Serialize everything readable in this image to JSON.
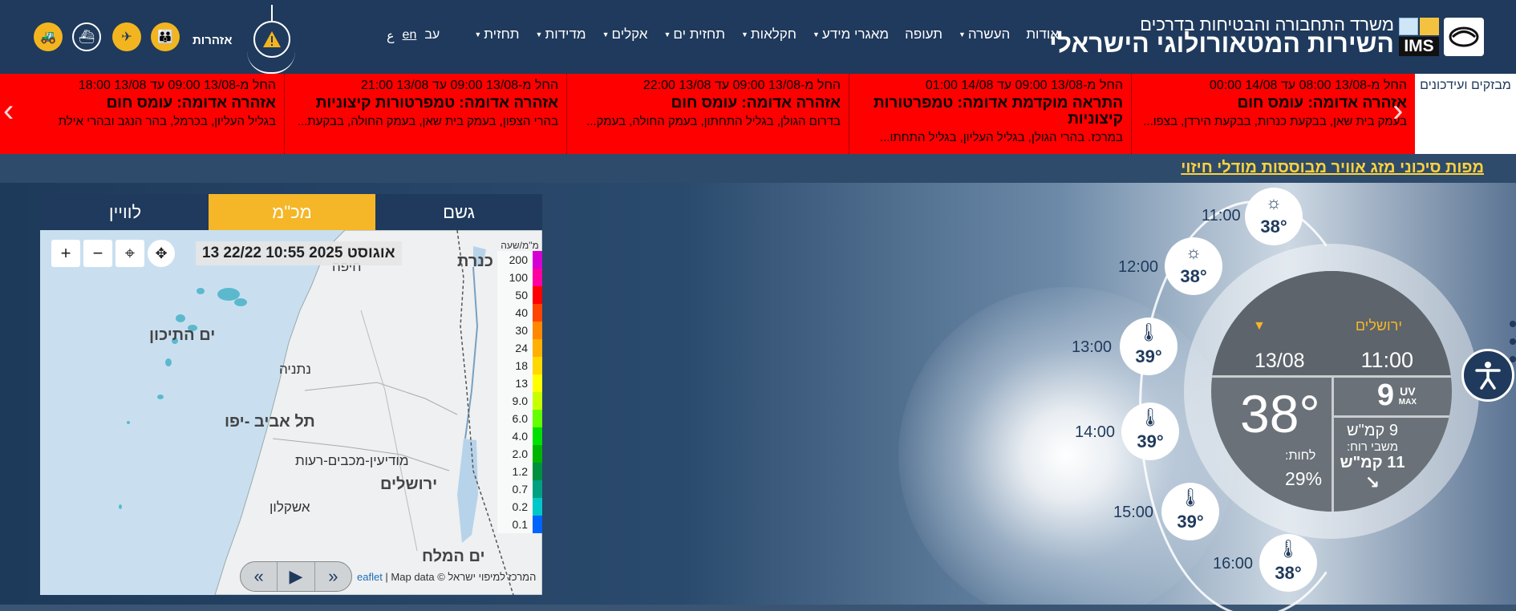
{
  "header": {
    "org_subtitle": "משרד התחבורה והבטיחות בדרכים",
    "org_title": "השירות המטאורולוגי הישראלי",
    "ims_logo_text": "IMS",
    "nav": [
      {
        "label": "תחזית",
        "caret": true
      },
      {
        "label": "מדידות",
        "caret": true
      },
      {
        "label": "אקלים",
        "caret": true
      },
      {
        "label": "תחזית ים",
        "caret": true
      },
      {
        "label": "חקלאות",
        "caret": true
      },
      {
        "label": "מאגרי מידע",
        "caret": true
      },
      {
        "label": "תעופה",
        "caret": false
      },
      {
        "label": "העשרה",
        "caret": true
      },
      {
        "label": "אודות",
        "caret": false
      }
    ],
    "lang_he": "עב",
    "lang_en": "en",
    "lang_ar": "ع",
    "alerts_label": "אזהרות",
    "icons": [
      "warning-icon",
      "people-icon",
      "plane-icon",
      "ship-icon",
      "tractor-icon"
    ]
  },
  "warnings": {
    "tab_label": "מבזקים ועידכונים",
    "cards": [
      {
        "time": "החל מ-13/08 08:00 עד 14/08 00:00",
        "title": "אזהרה אדומה: עומס חום",
        "area": "בעמק בית שאן, בבקעת כנרות, בבקעת הירדן, בצפו..."
      },
      {
        "time": "החל מ-13/08 09:00 עד 14/08 01:00",
        "title": "התראה מוקדמת אדומה: טמפרטורות קיצוניות",
        "area": "במרכז. בהרי הגולן, בגליל העליון, בגליל התחתו..."
      },
      {
        "time": "החל מ-13/08 09:00 עד 13/08 22:00",
        "title": "אזהרה אדומה: עומס חום",
        "area": "בדרום הגולן, בגליל התחתון, בעמק החולה, בעמק..."
      },
      {
        "time": "החל מ-13/08 09:00 עד 13/08 21:00",
        "title": "אזהרה אדומה: טמפרטורות קיצוניות",
        "area": "בהרי הצפון, בעמק בית שאן, בעמק החולה, בבקעת..."
      },
      {
        "time": "החל מ-13/08 09:00 עד 13/08 18:00",
        "title": "אזהרה אדומה: עומס חום",
        "area": "בגליל העליון, בכרמל, בהר הנגב ובהרי אילת"
      }
    ],
    "color": "#ff0000"
  },
  "risk_link": "מפות סיכוני מזג אוויר מבוססות מודלי חיזוי",
  "map": {
    "tabs": [
      "גשם",
      "מכ\"מ",
      "לוויין"
    ],
    "active_tab": 1,
    "timestamp": "13 אוגוסט 2025 10:55 22/22",
    "legend_unit": "מ\"מ/שעה",
    "legend": [
      {
        "v": "200",
        "c": "#d400d4"
      },
      {
        "v": "100",
        "c": "#ff00a0"
      },
      {
        "v": "50",
        "c": "#ff0000"
      },
      {
        "v": "40",
        "c": "#ff4400"
      },
      {
        "v": "30",
        "c": "#ff8800"
      },
      {
        "v": "24",
        "c": "#ffb000"
      },
      {
        "v": "18",
        "c": "#ffd800"
      },
      {
        "v": "13",
        "c": "#ffff00"
      },
      {
        "v": "9.0",
        "c": "#c8ff00"
      },
      {
        "v": "6.0",
        "c": "#64ff00"
      },
      {
        "v": "4.0",
        "c": "#00e000"
      },
      {
        "v": "2.0",
        "c": "#00b400"
      },
      {
        "v": "1.2",
        "c": "#009040"
      },
      {
        "v": "0.7",
        "c": "#00a080"
      },
      {
        "v": "0.2",
        "c": "#00c8c8"
      },
      {
        "v": "0.1",
        "c": "#0064ff"
      }
    ],
    "labels": {
      "sea": "ים התיכון",
      "tlv": "תל אביב -יפו",
      "netanya": "נתניה",
      "modiin": "מודיעין-מכבים-רעות",
      "jerusalem": "ירושלים",
      "ashkelon": "אשקלון",
      "kinneret": "כנרת",
      "deadsea": "ים המלח",
      "haifa": "חיפה"
    },
    "attribution_prefix": "eaflet",
    "attribution_rest": " | Map data © המרכז למיפוי ישראל"
  },
  "clock": {
    "city": "ירושלים",
    "time": "11:00",
    "date": "13/08",
    "temp": "38°",
    "humidity_label": "לחות:",
    "humidity": "29%",
    "uv_value": "9",
    "uv_label": "UV",
    "uv_max": "MAX",
    "wind": "9 קמ\"ש",
    "gust_label": "משבי רוח:",
    "gust": "11 קמ\"ש",
    "wind_arrow": "↘",
    "hours": [
      {
        "time": "11:00",
        "temp": "38°",
        "icon": "sun-icon"
      },
      {
        "time": "12:00",
        "temp": "38°",
        "icon": "sun-icon"
      },
      {
        "time": "13:00",
        "temp": "39°",
        "icon": "thermometer-icon"
      },
      {
        "time": "14:00",
        "temp": "39°",
        "icon": "thermometer-icon"
      },
      {
        "time": "15:00",
        "temp": "39°",
        "icon": "thermometer-icon"
      },
      {
        "time": "16:00",
        "temp": "38°",
        "icon": "thermometer-icon"
      }
    ]
  }
}
